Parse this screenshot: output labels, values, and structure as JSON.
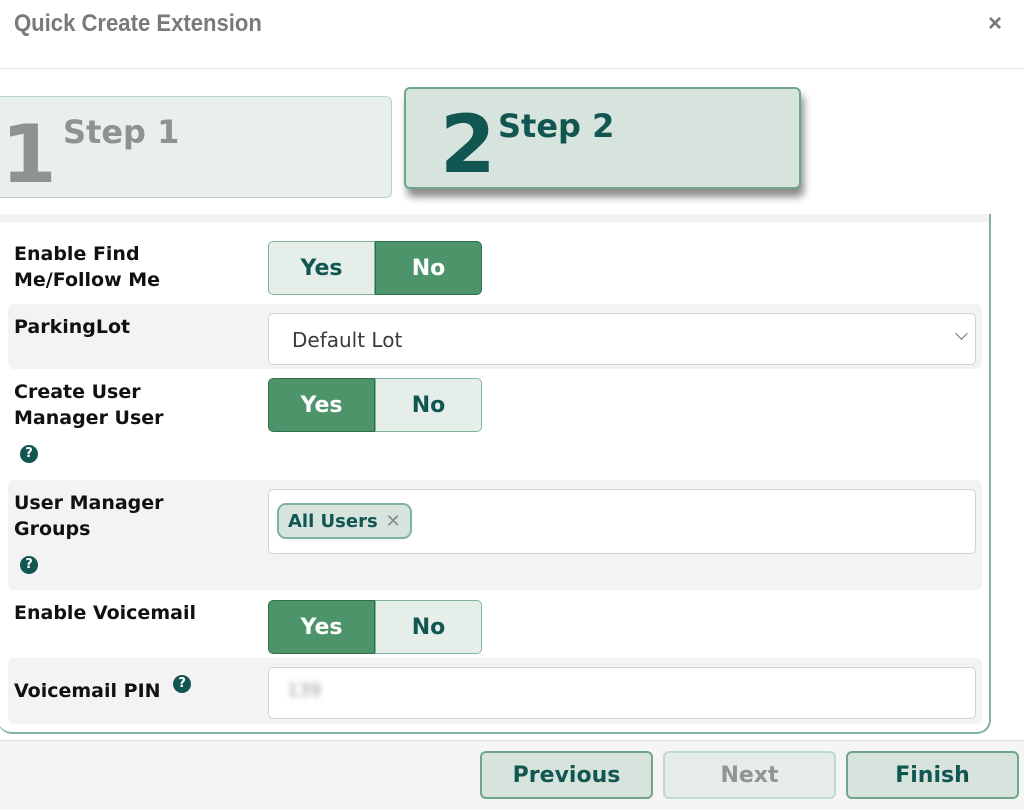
{
  "dialog": {
    "title": "Quick Create Extension",
    "close_icon": "×"
  },
  "steps": [
    {
      "number": "1",
      "label": "Step 1",
      "active": false
    },
    {
      "number": "2",
      "label": "Step 2",
      "active": true
    }
  ],
  "form": {
    "find_me": {
      "label_line1": "Enable Find",
      "label_line2": "Me/Follow Me",
      "yes": "Yes",
      "no": "No",
      "selected": "No"
    },
    "parking_lot": {
      "label": "ParkingLot",
      "value": "Default Lot"
    },
    "create_user": {
      "label_line1": "Create User",
      "label_line2": "Manager User",
      "help": "?",
      "yes": "Yes",
      "no": "No",
      "selected": "Yes"
    },
    "groups": {
      "label_line1": "User Manager",
      "label_line2": "Groups",
      "help": "?",
      "chips": [
        {
          "label": "All Users",
          "remove": "✕"
        }
      ]
    },
    "voicemail": {
      "label": "Enable Voicemail",
      "yes": "Yes",
      "no": "No",
      "selected": "Yes"
    },
    "voicemail_pin": {
      "label": "Voicemail PIN",
      "help": "?",
      "value": "139"
    }
  },
  "footer": {
    "previous": "Previous",
    "next": "Next",
    "finish": "Finish"
  },
  "colors": {
    "accent_dark": "#125652",
    "accent_green": "#4d946b",
    "border_green": "#7fb39a"
  }
}
